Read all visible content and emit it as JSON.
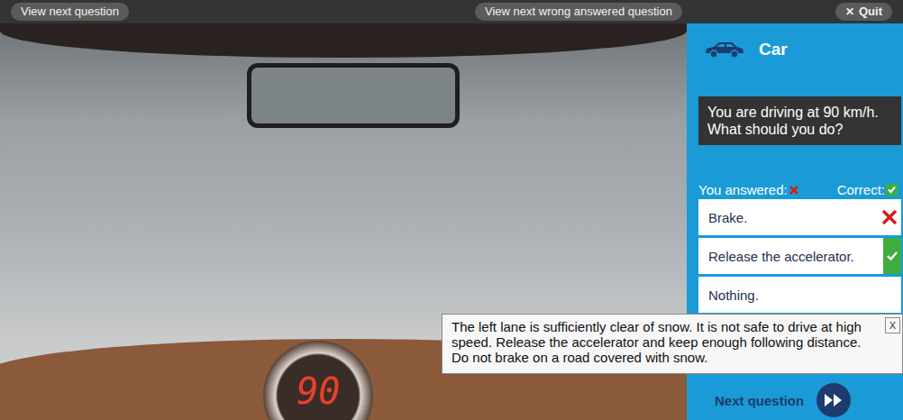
{
  "toolbar": {
    "buttons": [
      {
        "label": "View next question",
        "icon": ""
      },
      {
        "label": "View next wrong answered question",
        "icon": ""
      },
      {
        "label": "Quit",
        "icon": "✕"
      }
    ]
  },
  "category": {
    "label": "Car"
  },
  "speedometer": {
    "reading": "90"
  },
  "question": "You are driving at 90 km/h. What should you do?",
  "answer_header": {
    "you_answered": "You answered:",
    "correct": "Correct:"
  },
  "answers": [
    {
      "label": "Brake.",
      "chosen": true,
      "correct": false
    },
    {
      "label": "Release the accelerator.",
      "chosen": false,
      "correct": true
    },
    {
      "label": "Nothing.",
      "chosen": false,
      "correct": false
    }
  ],
  "explanation": {
    "text": "The left lane is sufficiently clear of snow. It is not safe to drive at high speed. Release the accelerator and keep enough following distance. Do not brake on a road covered with snow.",
    "close": "X"
  },
  "next": {
    "label": "Next question"
  }
}
